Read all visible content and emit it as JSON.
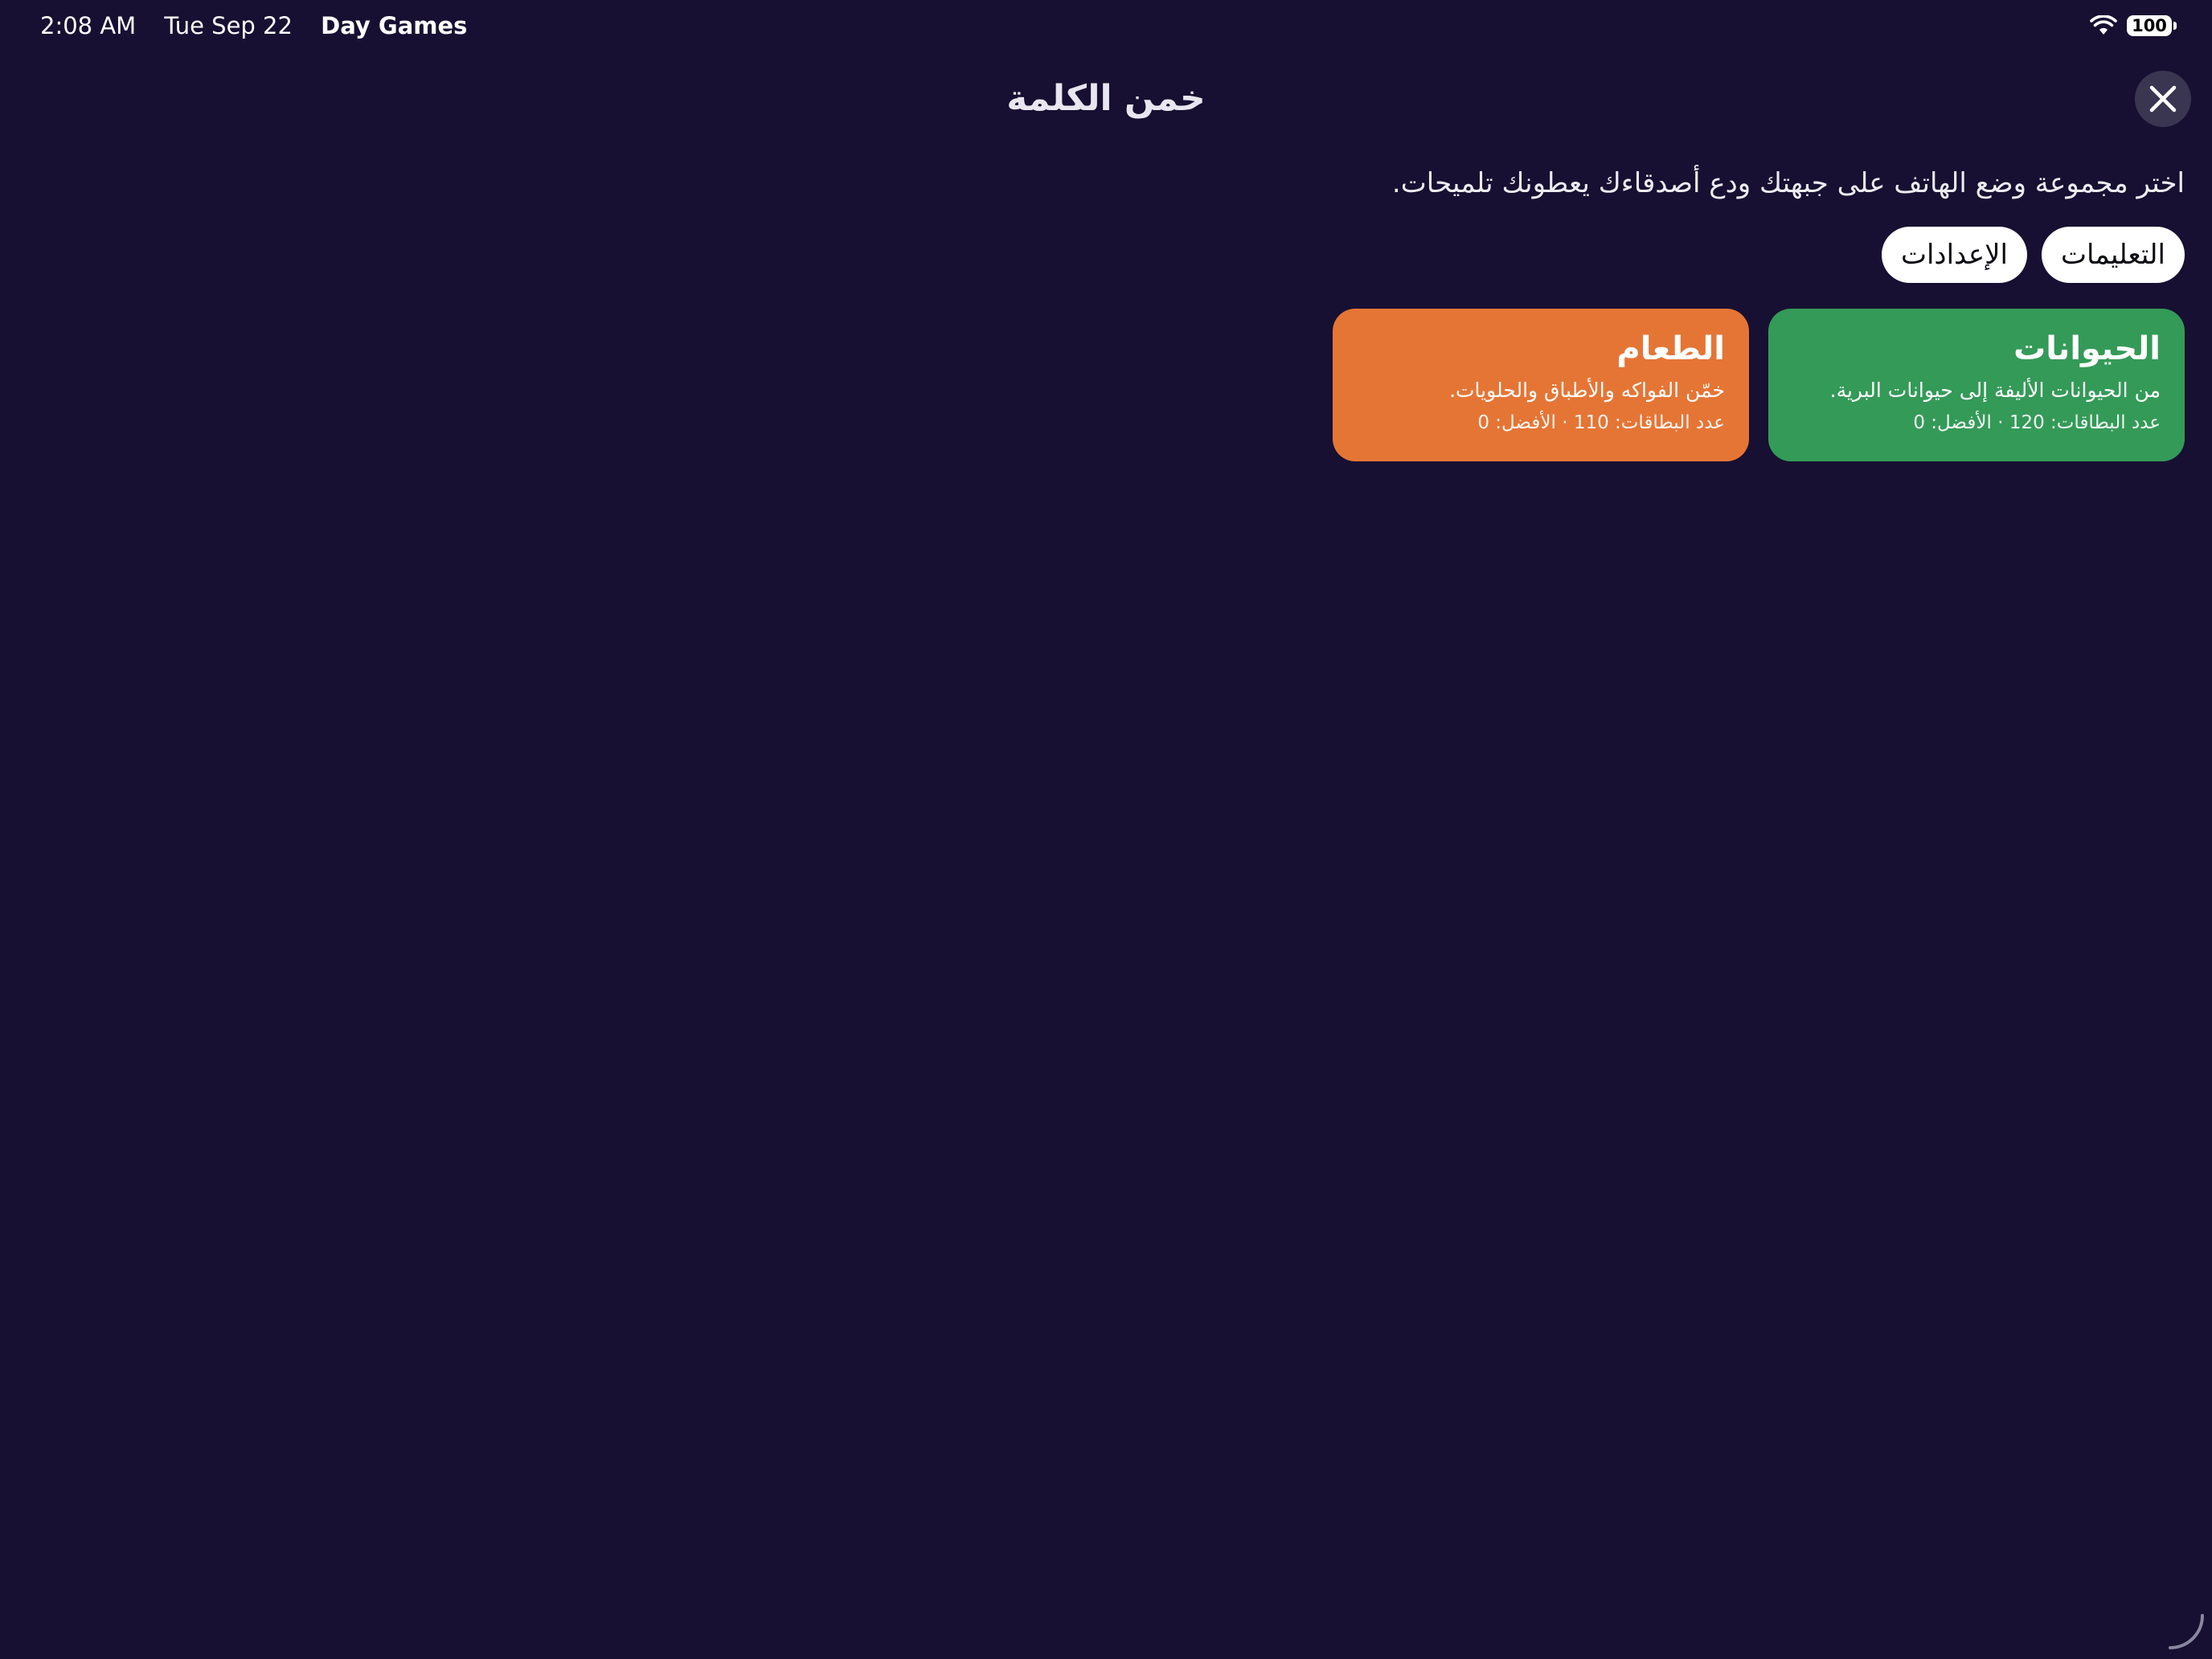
{
  "status_bar": {
    "time": "2:08 AM",
    "date": "Tue Sep 22",
    "app_name": "Day Games",
    "battery": "100"
  },
  "header": {
    "title": "خمن الكلمة"
  },
  "intro": {
    "text": "اختر مجموعة وضع الهاتف على جبهتك ودع أصدقاءك يعطونك تلميحات."
  },
  "buttons": {
    "instructions": "التعليمات",
    "settings": "الإعدادات"
  },
  "categories": [
    {
      "title": "الحيوانات",
      "description": "من الحيوانات الأليفة إلى حيوانات البرية.",
      "meta": "عدد البطاقات: 120 · الأفضل: 0",
      "color": "#349a57"
    },
    {
      "title": "الطعام",
      "description": "خمّن الفواكه والأطباق والحلويات.",
      "meta": "عدد البطاقات: 110 · الأفضل: 0",
      "color": "#e57535"
    }
  ],
  "icons": {
    "close": "close-icon",
    "wifi": "wifi-icon",
    "battery": "battery-icon"
  }
}
